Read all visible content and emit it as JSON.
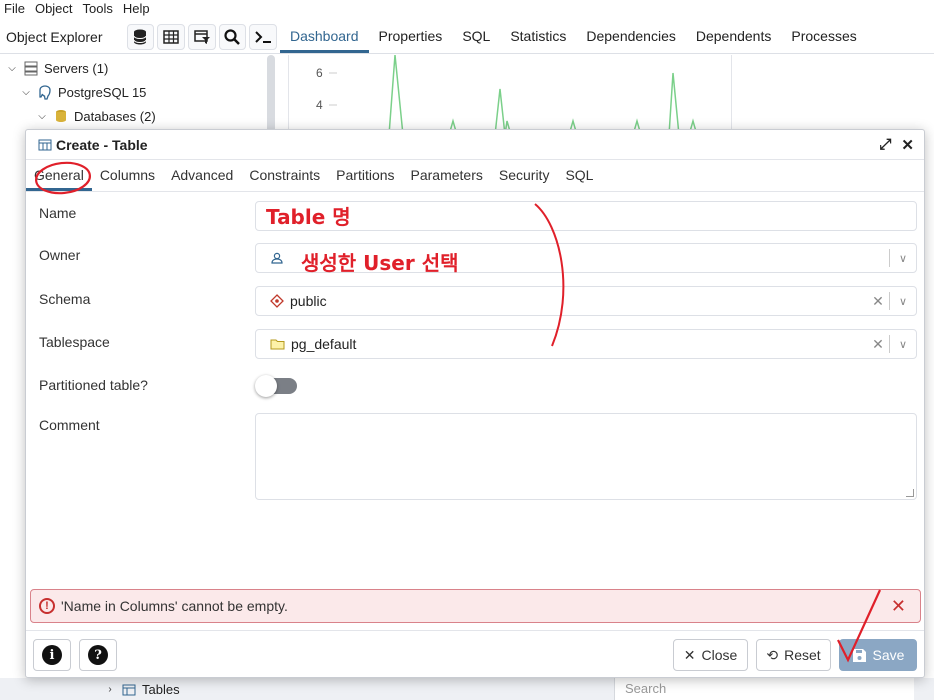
{
  "menubar": [
    "File",
    "Object",
    "Tools",
    "Help"
  ],
  "explorer": {
    "title": "Object Explorer",
    "tools": [
      "database-icon",
      "table-grid-icon",
      "filter-icon",
      "search-icon",
      "terminal-icon"
    ]
  },
  "main_tabs": [
    {
      "label": "Dashboard",
      "active": true
    },
    {
      "label": "Properties"
    },
    {
      "label": "SQL"
    },
    {
      "label": "Statistics"
    },
    {
      "label": "Dependencies"
    },
    {
      "label": "Dependents"
    },
    {
      "label": "Processes"
    }
  ],
  "tree": {
    "servers": "Servers (1)",
    "server": "PostgreSQL 15",
    "databases": "Databases (2)",
    "tables": "Tables"
  },
  "dashboard": {
    "y_ticks": [
      "6",
      "4"
    ]
  },
  "bottom": {
    "search_placeholder": "Search"
  },
  "dialog": {
    "title": "Create - Table",
    "tabs": [
      "General",
      "Columns",
      "Advanced",
      "Constraints",
      "Partitions",
      "Parameters",
      "Security",
      "SQL"
    ],
    "active_tab": "General",
    "fields": {
      "name_label": "Name",
      "name_value": "",
      "owner_label": "Owner",
      "owner_value": "",
      "schema_label": "Schema",
      "schema_value": "public",
      "tablespace_label": "Tablespace",
      "tablespace_value": "pg_default",
      "partitioned_label": "Partitioned table?",
      "partitioned_value": false,
      "comment_label": "Comment",
      "comment_value": ""
    },
    "error": "'Name in Columns' cannot be empty.",
    "buttons": {
      "close": "Close",
      "reset": "Reset",
      "save": "Save"
    }
  },
  "annotations": {
    "name_note": "Table 명",
    "owner_note": "생성한 User 선택"
  },
  "colors": {
    "accent": "#326690",
    "error": "#c7302f",
    "save_bg": "#8ba7c4",
    "annotation": "#e0202a"
  }
}
